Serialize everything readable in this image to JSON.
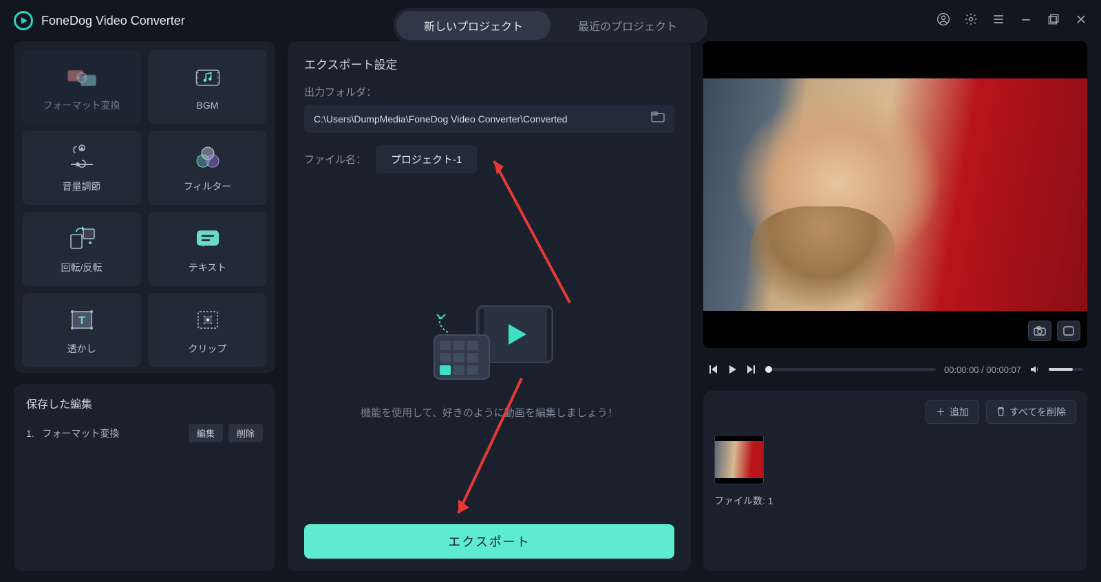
{
  "app": {
    "title": "FoneDog Video Converter"
  },
  "tabs": {
    "new": "新しいプロジェクト",
    "recent": "最近のプロジェクト"
  },
  "tools": [
    {
      "label": "フォーマット変換",
      "icon": "convert"
    },
    {
      "label": "BGM",
      "icon": "bgm"
    },
    {
      "label": "音量調節",
      "icon": "volume"
    },
    {
      "label": "フィルター",
      "icon": "filter"
    },
    {
      "label": "回転/反転",
      "icon": "rotate"
    },
    {
      "label": "テキスト",
      "icon": "text"
    },
    {
      "label": "透かし",
      "icon": "watermark"
    },
    {
      "label": "クリップ",
      "icon": "clip"
    }
  ],
  "saved": {
    "title": "保存した編集",
    "items": [
      {
        "index": "1.",
        "name": "フォーマット変換",
        "edit": "編集",
        "del": "削除"
      }
    ]
  },
  "export": {
    "section_title": "エクスポート設定",
    "folder_label": "出力フォルダ：",
    "folder_path": "C:\\Users\\DumpMedia\\FoneDog Video Converter\\Converted",
    "filename_label": "ファイル名：",
    "filename_value": "プロジェクト-1",
    "hint": "機能を使用して、好きのように動画を編集しましょう！",
    "button": "エクスポート"
  },
  "player": {
    "time_current": "00:00:00",
    "time_total": "00:00:07",
    "sep": " / "
  },
  "thumbs": {
    "add": "追加",
    "delete_all": "すべてを削除",
    "count_label": "ファイル数:",
    "count_value": "1"
  }
}
